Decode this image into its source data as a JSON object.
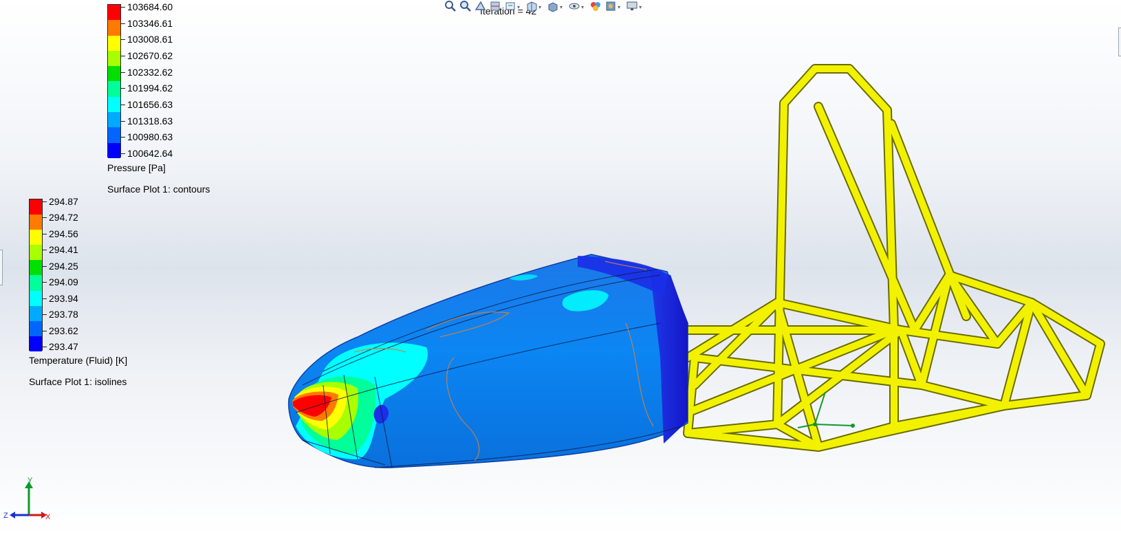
{
  "status": {
    "iteration": "Iteration = 42"
  },
  "toolbar": {
    "buttons": [
      {
        "name": "zoom-to-fit-icon",
        "dropdown": false
      },
      {
        "name": "zoom-to-area-icon",
        "dropdown": false
      },
      {
        "name": "previous-view-icon",
        "dropdown": false
      },
      {
        "name": "section-view-icon",
        "dropdown": false
      },
      {
        "name": "dynamic-annotation-icon",
        "dropdown": true
      },
      {
        "name": "view-orientation-icon",
        "dropdown": true
      },
      {
        "name": "display-style-icon",
        "dropdown": true
      },
      {
        "name": "hide-show-items-icon",
        "dropdown": true
      },
      {
        "name": "edit-appearance-icon",
        "dropdown": false
      },
      {
        "name": "apply-scene-icon",
        "dropdown": true
      },
      {
        "name": "view-settings-icon",
        "dropdown": true
      }
    ]
  },
  "pressure_legend": {
    "ticks": [
      "103684.60",
      "103346.61",
      "103008.61",
      "102670.62",
      "102332.62",
      "101994.62",
      "101656.63",
      "101318.63",
      "100980.63",
      "100642.64"
    ],
    "title": "Pressure [Pa]",
    "subtitle": "Surface Plot 1: contours"
  },
  "temperature_legend": {
    "ticks": [
      "294.87",
      "294.72",
      "294.56",
      "294.41",
      "294.25",
      "294.09",
      "293.94",
      "293.78",
      "293.62",
      "293.47"
    ],
    "title": "Temperature (Fluid) [K]",
    "subtitle": "Surface Plot 1: isolines"
  },
  "colormap": [
    "#ff0000",
    "#ff7a00",
    "#ffff00",
    "#a8ff00",
    "#00e000",
    "#00ff9a",
    "#00ffff",
    "#00aaff",
    "#0066ff",
    "#0000ff"
  ],
  "triad": {
    "x": "X",
    "y": "Y",
    "z": "Z"
  },
  "colors": {
    "frame": "#f2f200",
    "frame_edge": "#6b6b00",
    "body_blue": "#0a82f0",
    "body_edge_blue": "#1e2ae0",
    "isoline": "#d08040"
  }
}
